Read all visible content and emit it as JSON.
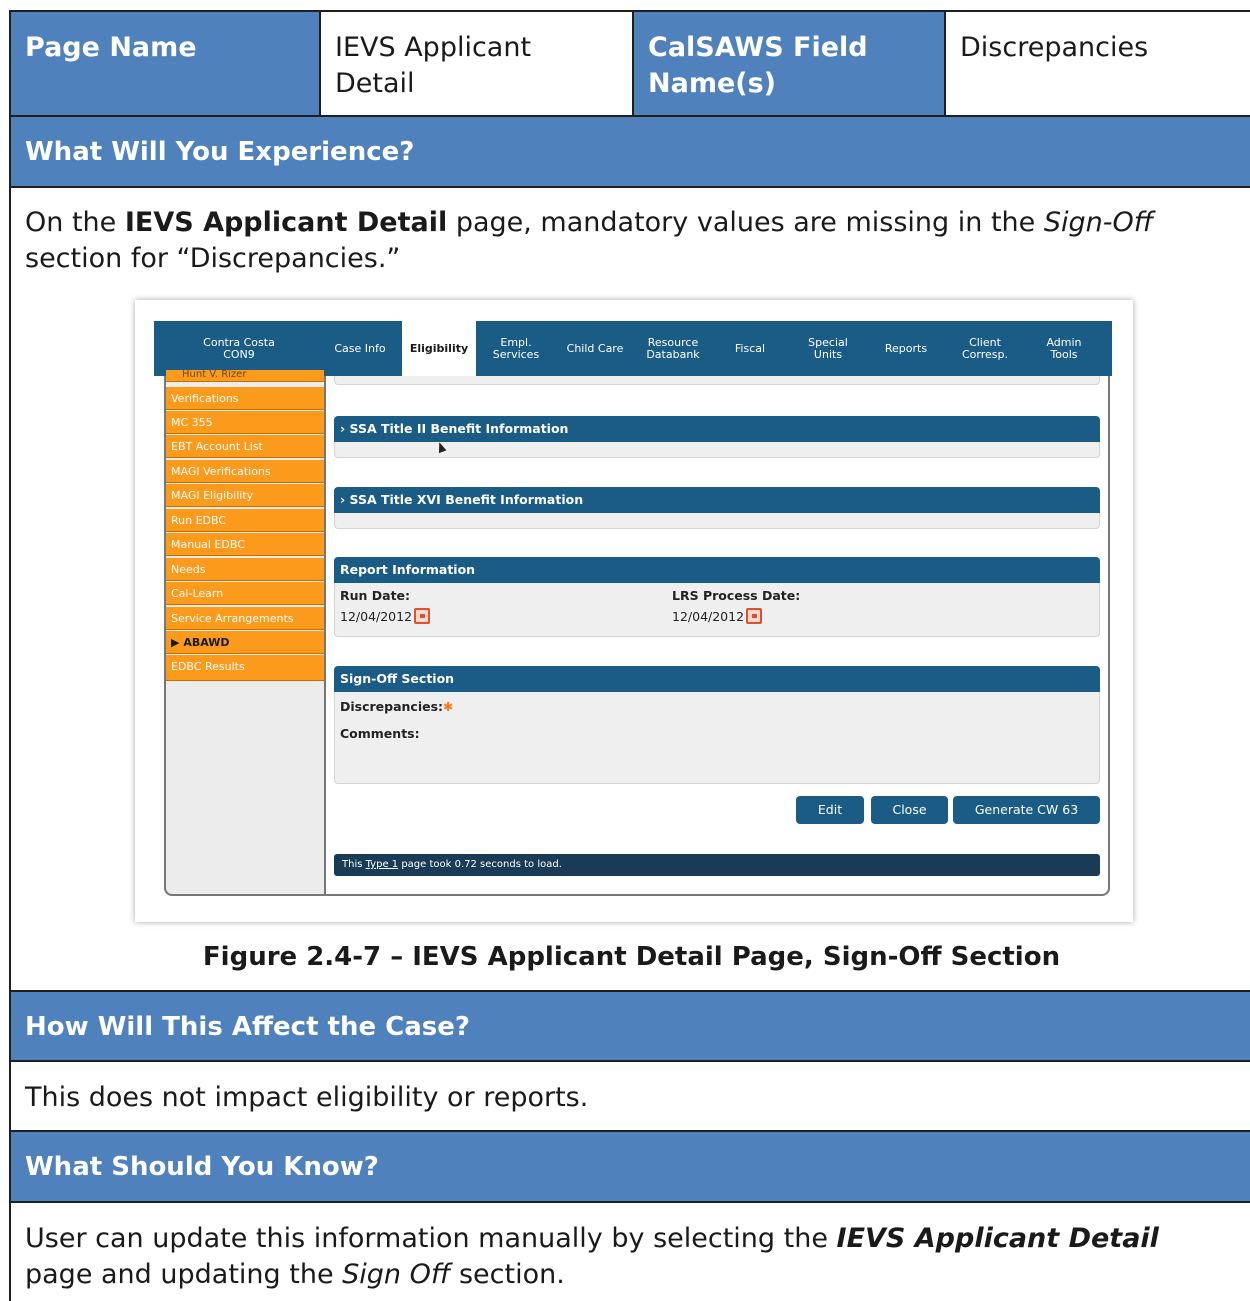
{
  "header": {
    "page_name_label": "Page Name",
    "page_name_value_line1": "IEVS Applicant",
    "page_name_value_line2": "Detail",
    "field_label_line1": "CalSAWS Field",
    "field_label_line2": "Name(s)",
    "field_value": "Discrepancies"
  },
  "experience": {
    "heading": "What Will You Experience?",
    "text_a": "On the ",
    "text_b": "IEVS Applicant Detail",
    "text_c": " page, mandatory values are missing in the ",
    "text_d": "Sign-Off",
    "text_e": "section for “Discrepancies.”"
  },
  "screenshot": {
    "nav": {
      "county_line1": "Contra Costa",
      "county_line2": "CON9",
      "items": [
        {
          "line1": "Case Info",
          "line2": ""
        },
        {
          "line1": "Eligibility",
          "line2": ""
        },
        {
          "line1": "Empl.",
          "line2": "Services"
        },
        {
          "line1": "Child Care",
          "line2": ""
        },
        {
          "line1": "Resource",
          "line2": "Databank"
        },
        {
          "line1": "Fiscal",
          "line2": ""
        },
        {
          "line1": "Special",
          "line2": "Units"
        },
        {
          "line1": "Reports",
          "line2": ""
        },
        {
          "line1": "Client",
          "line2": "Corresp."
        },
        {
          "line1": "Admin",
          "line2": "Tools"
        }
      ]
    },
    "left_nav": {
      "partial_top": "Hunt V. Rizer",
      "items": [
        "Verifications",
        "MC 355",
        "EBT Account List",
        "MAGI Verifications",
        "MAGI Eligibility",
        "Run EDBC",
        "Manual EDBC",
        "Needs",
        "Cal-Learn",
        "Service Arrangements",
        "ABAWD",
        "EDBC Results"
      ],
      "active_item_marker": "▶"
    },
    "sections": {
      "ssa_title2": "› SSA Title II Benefit Information",
      "ssa_title16": "› SSA Title XVI Benefit Information",
      "report_info": "Report Information",
      "run_date_label": "Run Date:",
      "run_date_value": "12/04/2012",
      "lrs_label": "LRS Process Date:",
      "lrs_value": "12/04/2012",
      "signoff": "Sign-Off Section",
      "discrepancies_label": "Discrepancies:",
      "required_marker": "✱",
      "comments_label": "Comments:"
    },
    "buttons": {
      "edit": "Edit",
      "close": "Close",
      "generate": "Generate CW 63"
    },
    "status_a": "This ",
    "status_link": "Type 1",
    "status_b": " page took 0.72 seconds to load."
  },
  "figure_caption": "Figure 2.4-7 – IEVS Applicant Detail Page, Sign-Off Section",
  "affect": {
    "heading": "How Will This Affect the Case?",
    "text": "This does not impact eligibility or reports."
  },
  "know": {
    "heading": "What Should You Know?",
    "text_a": "User can update this information manually by selecting the ",
    "text_b": "IEVS Applicant Detail",
    "text_c": "page and updating the ",
    "text_d": "Sign Off",
    "text_e": " section."
  },
  "colors": {
    "band_blue": "#4f81bd",
    "app_nav_blue": "#1a5c86",
    "left_nav_orange": "#fb9a1b"
  }
}
